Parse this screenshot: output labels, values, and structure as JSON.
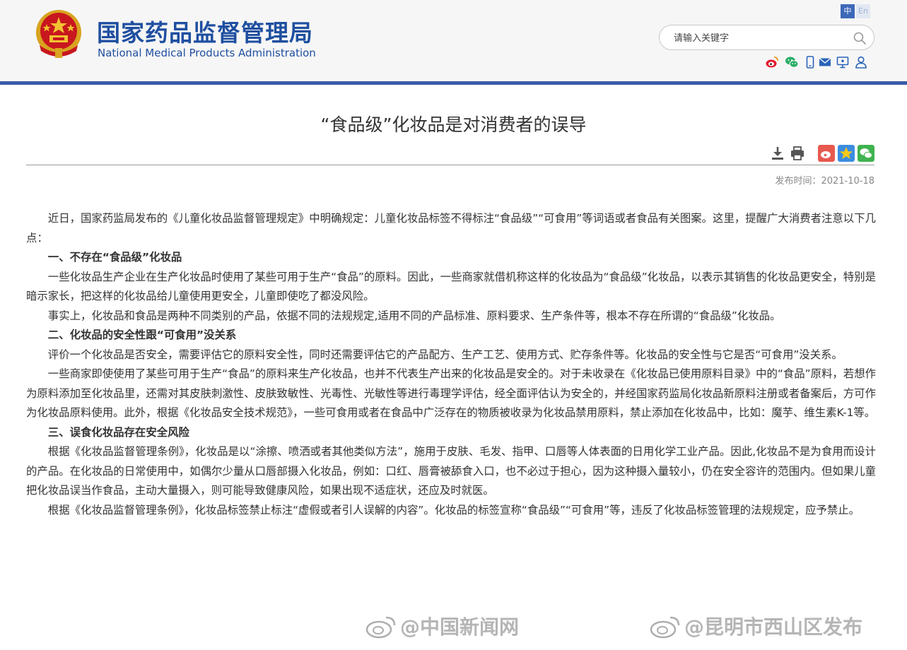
{
  "header": {
    "title_cn": "国家药品监督管理局",
    "title_en": "National Medical Products Administration",
    "lang_cn": "中",
    "lang_en": "En",
    "search_placeholder": "请输入关键字",
    "social_icons": [
      "weibo-icon",
      "wechat-icon",
      "mobile-icon",
      "mail-icon",
      "monitor-icon",
      "user-icon"
    ],
    "brand_color": "#1f4fa0",
    "bar_color": "#3c5aa8"
  },
  "article": {
    "title": "“食品级”化妆品是对消费者的误导",
    "date_label": "发布时间：2021-10-18",
    "tools": [
      "download-icon",
      "print-icon"
    ],
    "share": [
      "share-weibo-icon",
      "share-qzone-icon",
      "share-wechat-icon"
    ],
    "blocks": [
      {
        "type": "p",
        "text": "近日，国家药监局发布的《儿童化妆品监督管理规定》中明确规定：儿童化妆品标签不得标注“食品级”“可食用”等词语或者食品有关图案。这里，提醒广大消费者注意以下几点："
      },
      {
        "type": "h",
        "text": "一、不存在“食品级”化妆品"
      },
      {
        "type": "p",
        "text": "一些化妆品生产企业在生产化妆品时使用了某些可用于生产“食品”的原料。因此，一些商家就借机称这样的化妆品为“食品级”化妆品，以表示其销售的化妆品更安全，特别是暗示家长，把这样的化妆品给儿童使用更安全，儿童即使吃了都没风险。"
      },
      {
        "type": "p",
        "text": "事实上，化妆品和食品是两种不同类别的产品，依据不同的法规规定,适用不同的产品标准、原料要求、生产条件等，根本不存在所谓的“食品级”化妆品。"
      },
      {
        "type": "h",
        "text": "二、化妆品的安全性跟“可食用”没关系"
      },
      {
        "type": "p",
        "text": "评价一个化妆品是否安全，需要评估它的原料安全性，同时还需要评估它的产品配方、生产工艺、使用方式、贮存条件等。化妆品的安全性与它是否“可食用”没关系。"
      },
      {
        "type": "p",
        "text": "一些商家即使使用了某些可用于生产“食品”的原料来生产化妆品，也并不代表生产出来的化妆品是安全的。对于未收录在《化妆品已使用原料目录》中的“食品”原料，若想作为原料添加至化妆品里，还需对其皮肤刺激性、皮肤致敏性、光毒性、光敏性等进行毒理学评估，经全面评估认为安全的，并经国家药监局化妆品新原料注册或者备案后，方可作为化妆品原料使用。此外，根据《化妆品安全技术规范》，一些可食用或者在食品中广泛存在的物质被收录为化妆品禁用原料，禁止添加在化妆品中，比如：魔芋、维生素K-1等。"
      },
      {
        "type": "h",
        "text": "三、误食化妆品存在安全风险"
      },
      {
        "type": "p",
        "text": "根据《化妆品监督管理条例》，化妆品是以“涂擦、喷洒或者其他类似方法”，施用于皮肤、毛发、指甲、口唇等人体表面的日用化学工业产品。因此,化妆品不是为食用而设计的产品。在化妆品的日常使用中，如偶尔少量从口唇部摄入化妆品，例如：口红、唇膏被舔食入口，也不必过于担心，因为这种摄入量较小，仍在安全容许的范围内。但如果儿童把化妆品误当作食品，主动大量摄入，则可能导致健康风险，如果出现不适症状，还应及时就医。"
      },
      {
        "type": "p",
        "text": "根据《化妆品监督管理条例》，化妆品标签禁止标注“虚假或者引人误解的内容”。化妆品的标签宣称“食品级”“可食用”等，违反了化妆品标签管理的法规规定，应予禁止。"
      }
    ]
  },
  "watermarks": {
    "left": "@中国新闻网",
    "right": "@昆明市西山区发布"
  }
}
